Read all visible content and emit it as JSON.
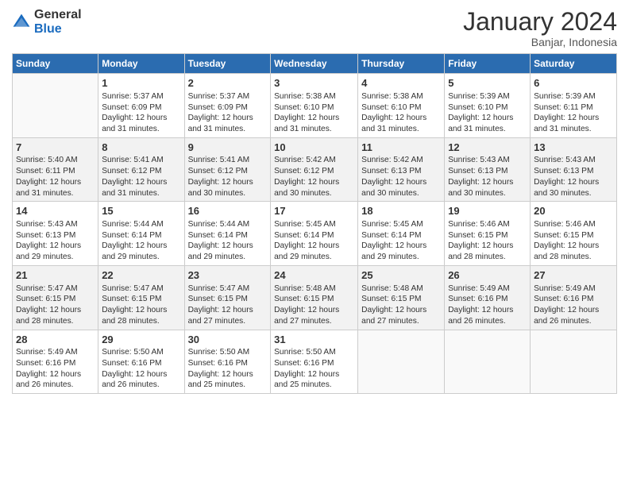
{
  "logo": {
    "general": "General",
    "blue": "Blue"
  },
  "header": {
    "month": "January 2024",
    "location": "Banjar, Indonesia"
  },
  "weekdays": [
    "Sunday",
    "Monday",
    "Tuesday",
    "Wednesday",
    "Thursday",
    "Friday",
    "Saturday"
  ],
  "weeks": [
    [
      {
        "day": "",
        "info": ""
      },
      {
        "day": "1",
        "info": "Sunrise: 5:37 AM\nSunset: 6:09 PM\nDaylight: 12 hours and 31 minutes."
      },
      {
        "day": "2",
        "info": "Sunrise: 5:37 AM\nSunset: 6:09 PM\nDaylight: 12 hours and 31 minutes."
      },
      {
        "day": "3",
        "info": "Sunrise: 5:38 AM\nSunset: 6:10 PM\nDaylight: 12 hours and 31 minutes."
      },
      {
        "day": "4",
        "info": "Sunrise: 5:38 AM\nSunset: 6:10 PM\nDaylight: 12 hours and 31 minutes."
      },
      {
        "day": "5",
        "info": "Sunrise: 5:39 AM\nSunset: 6:10 PM\nDaylight: 12 hours and 31 minutes."
      },
      {
        "day": "6",
        "info": "Sunrise: 5:39 AM\nSunset: 6:11 PM\nDaylight: 12 hours and 31 minutes."
      }
    ],
    [
      {
        "day": "7",
        "info": "Sunrise: 5:40 AM\nSunset: 6:11 PM\nDaylight: 12 hours and 31 minutes."
      },
      {
        "day": "8",
        "info": "Sunrise: 5:41 AM\nSunset: 6:12 PM\nDaylight: 12 hours and 31 minutes."
      },
      {
        "day": "9",
        "info": "Sunrise: 5:41 AM\nSunset: 6:12 PM\nDaylight: 12 hours and 30 minutes."
      },
      {
        "day": "10",
        "info": "Sunrise: 5:42 AM\nSunset: 6:12 PM\nDaylight: 12 hours and 30 minutes."
      },
      {
        "day": "11",
        "info": "Sunrise: 5:42 AM\nSunset: 6:13 PM\nDaylight: 12 hours and 30 minutes."
      },
      {
        "day": "12",
        "info": "Sunrise: 5:43 AM\nSunset: 6:13 PM\nDaylight: 12 hours and 30 minutes."
      },
      {
        "day": "13",
        "info": "Sunrise: 5:43 AM\nSunset: 6:13 PM\nDaylight: 12 hours and 30 minutes."
      }
    ],
    [
      {
        "day": "14",
        "info": "Sunrise: 5:43 AM\nSunset: 6:13 PM\nDaylight: 12 hours and 29 minutes."
      },
      {
        "day": "15",
        "info": "Sunrise: 5:44 AM\nSunset: 6:14 PM\nDaylight: 12 hours and 29 minutes."
      },
      {
        "day": "16",
        "info": "Sunrise: 5:44 AM\nSunset: 6:14 PM\nDaylight: 12 hours and 29 minutes."
      },
      {
        "day": "17",
        "info": "Sunrise: 5:45 AM\nSunset: 6:14 PM\nDaylight: 12 hours and 29 minutes."
      },
      {
        "day": "18",
        "info": "Sunrise: 5:45 AM\nSunset: 6:14 PM\nDaylight: 12 hours and 29 minutes."
      },
      {
        "day": "19",
        "info": "Sunrise: 5:46 AM\nSunset: 6:15 PM\nDaylight: 12 hours and 28 minutes."
      },
      {
        "day": "20",
        "info": "Sunrise: 5:46 AM\nSunset: 6:15 PM\nDaylight: 12 hours and 28 minutes."
      }
    ],
    [
      {
        "day": "21",
        "info": "Sunrise: 5:47 AM\nSunset: 6:15 PM\nDaylight: 12 hours and 28 minutes."
      },
      {
        "day": "22",
        "info": "Sunrise: 5:47 AM\nSunset: 6:15 PM\nDaylight: 12 hours and 28 minutes."
      },
      {
        "day": "23",
        "info": "Sunrise: 5:47 AM\nSunset: 6:15 PM\nDaylight: 12 hours and 27 minutes."
      },
      {
        "day": "24",
        "info": "Sunrise: 5:48 AM\nSunset: 6:15 PM\nDaylight: 12 hours and 27 minutes."
      },
      {
        "day": "25",
        "info": "Sunrise: 5:48 AM\nSunset: 6:15 PM\nDaylight: 12 hours and 27 minutes."
      },
      {
        "day": "26",
        "info": "Sunrise: 5:49 AM\nSunset: 6:16 PM\nDaylight: 12 hours and 26 minutes."
      },
      {
        "day": "27",
        "info": "Sunrise: 5:49 AM\nSunset: 6:16 PM\nDaylight: 12 hours and 26 minutes."
      }
    ],
    [
      {
        "day": "28",
        "info": "Sunrise: 5:49 AM\nSunset: 6:16 PM\nDaylight: 12 hours and 26 minutes."
      },
      {
        "day": "29",
        "info": "Sunrise: 5:50 AM\nSunset: 6:16 PM\nDaylight: 12 hours and 26 minutes."
      },
      {
        "day": "30",
        "info": "Sunrise: 5:50 AM\nSunset: 6:16 PM\nDaylight: 12 hours and 25 minutes."
      },
      {
        "day": "31",
        "info": "Sunrise: 5:50 AM\nSunset: 6:16 PM\nDaylight: 12 hours and 25 minutes."
      },
      {
        "day": "",
        "info": ""
      },
      {
        "day": "",
        "info": ""
      },
      {
        "day": "",
        "info": ""
      }
    ]
  ]
}
